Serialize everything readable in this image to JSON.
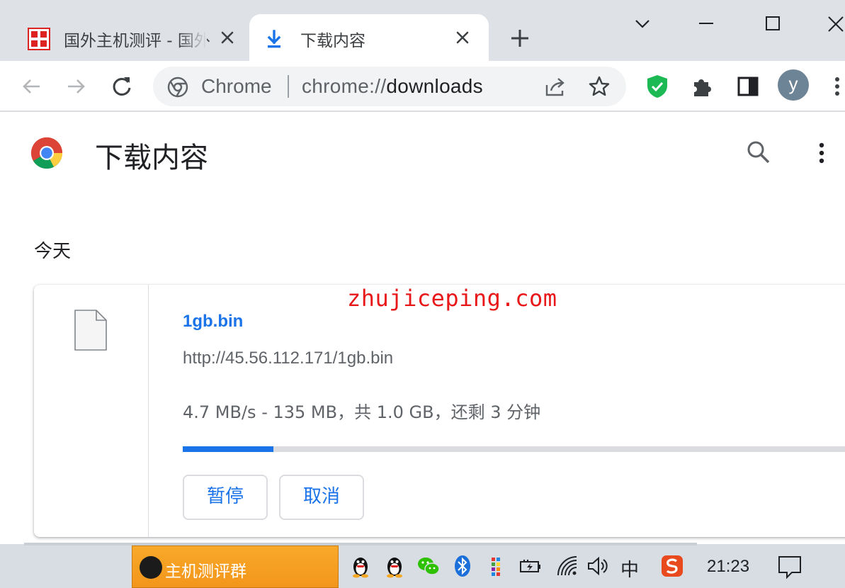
{
  "tabs": [
    {
      "title": "国外主机测评 - 国外",
      "favicon": "red-seal-icon",
      "active": false
    },
    {
      "title": "下载内容",
      "favicon": "download-icon",
      "active": true
    }
  ],
  "window_controls": [
    "chevron-down-icon",
    "minimize-icon",
    "maximize-icon",
    "close-icon"
  ],
  "toolbar": {
    "buttons": [
      "back-icon",
      "forward-icon",
      "reload-icon"
    ],
    "omnibox": {
      "label": "Chrome",
      "url_scheme": "chrome://",
      "url_host": "downloads"
    },
    "extensions": [
      "shield-check-icon",
      "puzzle-icon",
      "side-panel-icon"
    ],
    "avatar_letter": "y",
    "menu": "vertical-dots-icon"
  },
  "page": {
    "title": "下载内容",
    "section_date": "今天"
  },
  "download": {
    "file_name": "1gb.bin",
    "url": "http://45.56.112.171/1gb.bin",
    "status": "4.7 MB/s - 135 MB，共 1.0 GB，还剩 3 分钟",
    "progress": 0.135,
    "pause_label": "暂停",
    "cancel_label": "取消"
  },
  "watermark": "zhujiceping.com",
  "taskbar": {
    "app_label": "主机测评群",
    "ime": "中",
    "clock": "21:23"
  },
  "colors": {
    "tab_strip": "#dee1e6",
    "accent_blue": "#1a73e8",
    "watermark_red": "#e8181a",
    "taskbar_app": "#f3961b"
  }
}
